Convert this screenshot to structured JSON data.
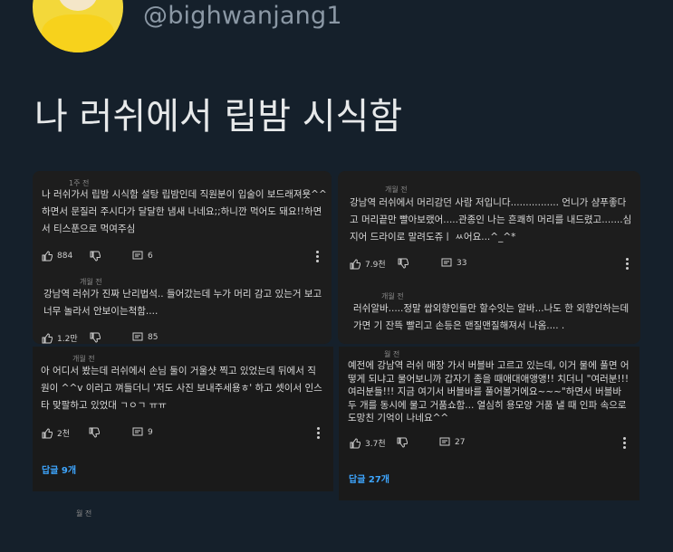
{
  "profile": {
    "handle": "@bighwanjang1"
  },
  "tweet": {
    "text": "나 러쉬에서 립밤 시식함"
  },
  "cards": [
    {
      "comment1": {
        "meta": "1주 전",
        "lines": [
          "나 러쉬가서 립밤 시식함 설탕 립밤인데 직원분이 입술이 보드래져욧^^",
          "하면서 문질러 주시다가 달달한 냄새 나네요;;하니깐 먹어도 돼요!!하면",
          "서 티스푼으로 먹여주심"
        ],
        "likes": "884",
        "replies_count": "6"
      },
      "comment2": {
        "meta": "개월 전",
        "lines": [
          "강남역 러쉬가 진짜 난리법석.. 들어갔는데 누가 머리 감고 있는거 보고",
          "너무 놀라서 안보이는척함...."
        ],
        "likes": "1.2만",
        "replies_count": "85"
      }
    },
    {
      "comment1": {
        "meta": "개월 전",
        "lines": [
          "강남역 러쉬에서 머리감던 사람 저입니다................ 언니가 샴푸좋다",
          "고 머리끝만 빨아보랬어.....관종인 나는 흔쾌히 머리를 내드렸고.......심",
          "지어 드라이로 말려도쥬ㅣ ㅆ어요...^_^*"
        ],
        "likes": "7.9천",
        "replies_count": "33"
      },
      "comment2": {
        "meta": "개월 전",
        "lines": [
          "러쉬알바.....정말 쌉외향인들만 할수잇는 알바...나도 한 외향인하는데",
          "가면 기 잔뜩 빨리고 손등은 맨질맨질해져서 나옴.... ."
        ]
      }
    },
    {
      "comment1": {
        "meta": "개월 전",
        "lines": [
          "아 어디서 봤는데 러쉬에서 손님 둘이 거울샷 찍고 있었는데 뒤에서 직",
          "원이 ^^v 이러고 껴들더니 '저도 사진 보내주세용ㅎ' 하고 셋이서 인스",
          "타 맞팔하고 있었대 ㄱㅇㄱ ㅠㅠ"
        ],
        "likes": "2천",
        "replies_count": "9"
      },
      "replies_link": "답글 9개",
      "cut_meta": "월 전"
    },
    {
      "comment1": {
        "meta": "월 전",
        "lines": [
          "예전에 강남역 러쉬 매장 가서 버블바 고르고 있는데, 이거 물에 풀면 어",
          "떻게 되냐고 물어보니까 갑자기 종을 때애대애앵앵!! 치더니 \"여러분!!!",
          "여러분들!!! 지금 여기서 버블바를 풀어볼거에요~~~\"하면서 버블바",
          "두 개를 동시에 물고 거품쇼함... 열심히 용모양 거품 낼 때 인파 속으로",
          "도망친 기억이 나네요^^"
        ],
        "likes": "3.7천",
        "replies_count": "27"
      },
      "replies_link": "답글 27개"
    }
  ],
  "icons": {
    "like": "thumbs-up-icon",
    "dislike": "thumbs-down-icon",
    "reply": "comment-reply-icon",
    "more": "more-vertical-icon"
  }
}
